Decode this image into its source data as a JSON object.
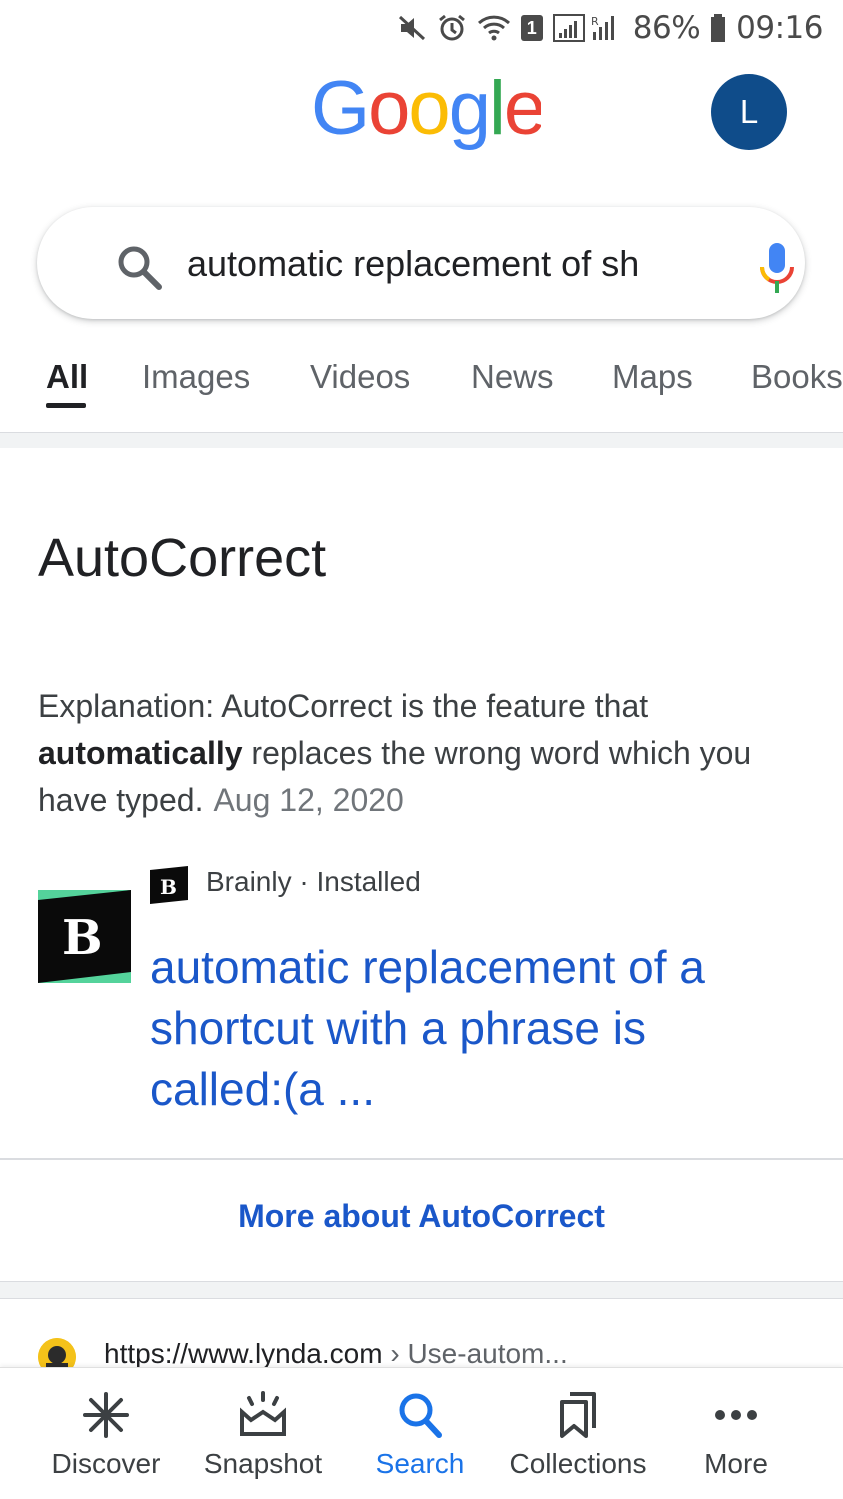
{
  "status_bar": {
    "battery": "86%",
    "time": "09:16",
    "sim_slot": "1",
    "icons": [
      "mute-icon",
      "alarm-icon",
      "wifi-icon",
      "signal-icon",
      "battery-icon"
    ]
  },
  "header": {
    "logo_text": "Google",
    "logo_colors": [
      "#4285F4",
      "#EA4335",
      "#FBBC05",
      "#4285F4",
      "#34A853",
      "#EA4335"
    ],
    "avatar_initial": "L",
    "avatar_color": "#0f4c8a"
  },
  "search": {
    "query": "automatic replacement of sh"
  },
  "tabs": [
    {
      "label": "All",
      "active": true
    },
    {
      "label": "Images"
    },
    {
      "label": "Videos"
    },
    {
      "label": "News"
    },
    {
      "label": "Maps"
    },
    {
      "label": "Books"
    }
  ],
  "answer": {
    "title": "AutoCorrect",
    "text_before": "Explanation: AutoCorrect is the feature that ",
    "text_bold": "automatically",
    "text_after": " replaces the wrong word which you have typed.",
    "date": "Aug 12, 2020",
    "source_name": "Brainly",
    "source_status": " · Installed",
    "source_link": "automatic replacement of a shortcut with a phrase is called:(a ...",
    "more_link": "More about AutoCorrect",
    "link_color": "#1a57c9"
  },
  "next_result": {
    "url": "https://www.lynda.com",
    "crumb": " › Use-autom..."
  },
  "bottom_nav": [
    {
      "label": "Discover",
      "icon": "asterisk-icon"
    },
    {
      "label": "Snapshot",
      "icon": "snapshot-icon"
    },
    {
      "label": "Search",
      "icon": "search-icon",
      "active": true
    },
    {
      "label": "Collections",
      "icon": "collections-icon"
    },
    {
      "label": "More",
      "icon": "more-icon"
    }
  ]
}
